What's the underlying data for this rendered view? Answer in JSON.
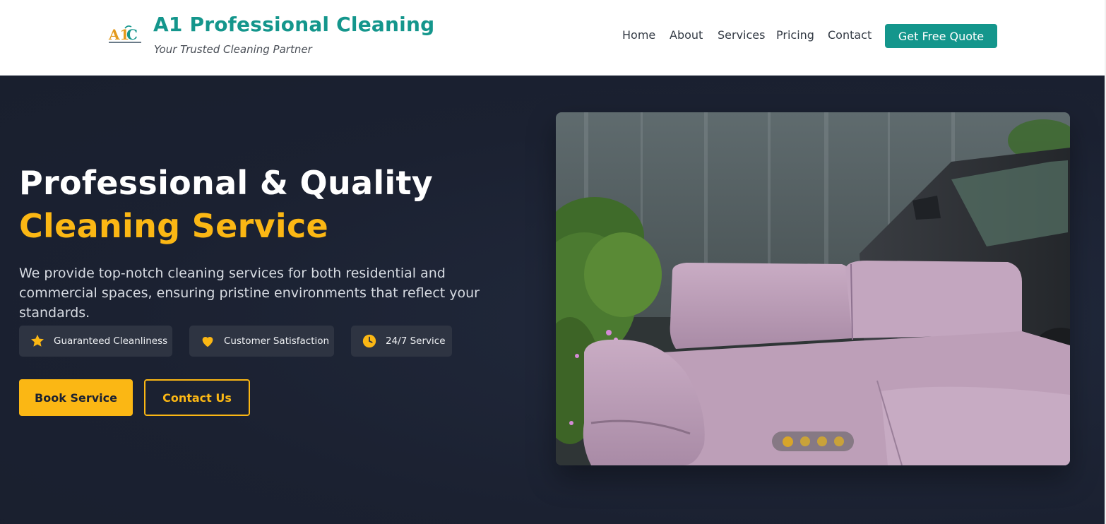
{
  "brand": {
    "name": "A1 Professional Cleaning",
    "tagline": "Your Trusted Cleaning Partner",
    "logo_icon": "a1c-logo-icon",
    "primary_color": "#14968c",
    "accent_color": "#fbb714"
  },
  "nav": {
    "items": [
      {
        "label": "Home"
      },
      {
        "label": "About"
      },
      {
        "label": "Services"
      },
      {
        "label": "Pricing"
      },
      {
        "label": "Contact"
      }
    ],
    "cta_label": "Get Free Quote"
  },
  "hero": {
    "title_line1": "Professional & Quality",
    "title_line2": "Cleaning Service",
    "description": "We provide top-notch cleaning services for both residential and commercial spaces, ensuring pristine environments that reflect your standards.",
    "features": [
      {
        "label": "Guaranteed Cleanliness",
        "icon": "star-icon"
      },
      {
        "label": "Customer Satisfaction",
        "icon": "heart-icon"
      },
      {
        "label": "24/7 Service",
        "icon": "clock-icon"
      }
    ],
    "primary_button": "Book Service",
    "secondary_button": "Contact Us"
  },
  "carousel": {
    "slide_count": 4,
    "active_slide": 1,
    "image_subject": "pink-sofa-outdoors"
  }
}
